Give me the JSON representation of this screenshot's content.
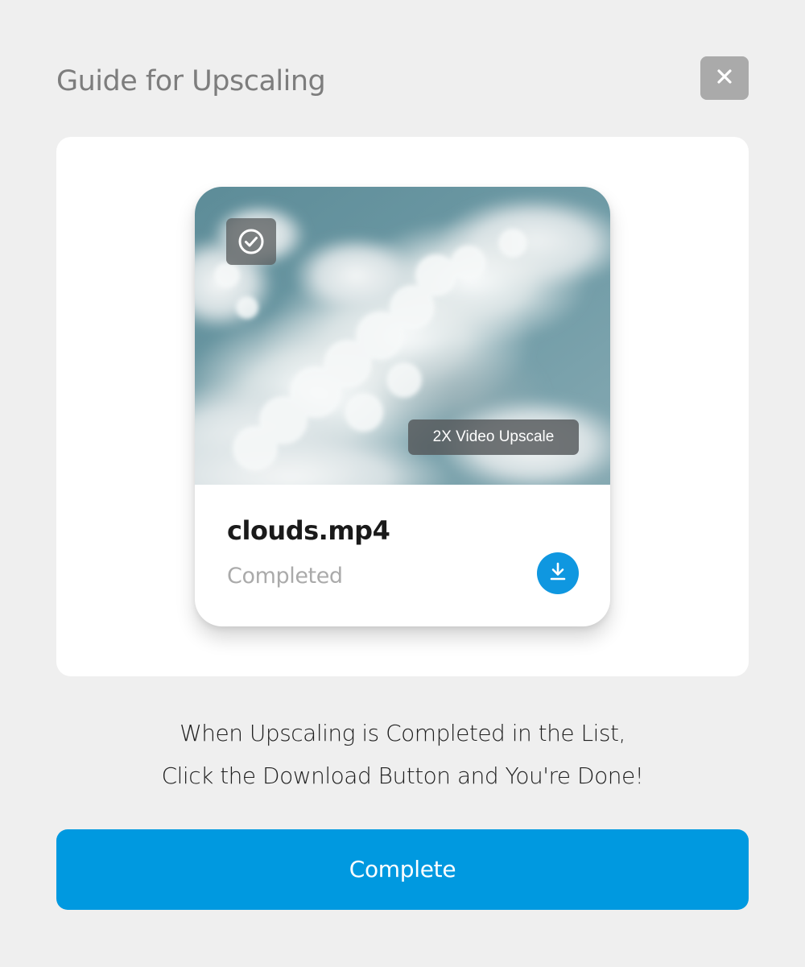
{
  "dialog": {
    "title": "Guide for Upscaling",
    "close_icon": "close-icon"
  },
  "preview": {
    "card": {
      "thumbnail_subject": "clouds-image",
      "select_icon": "check-circle-icon",
      "upscale_badge": "2X Video Upscale",
      "file_name": "clouds.mp4",
      "status": "Completed",
      "download_icon": "download-icon"
    }
  },
  "instructions": {
    "line1": "When Upscaling is Completed in the List,",
    "line2": "Click the Download Button and You're Done!"
  },
  "actions": {
    "complete_label": "Complete"
  },
  "colors": {
    "background": "#efefef",
    "accent": "#0099e0",
    "close_button": "#aaaaaa",
    "title": "#7d7d7d",
    "status_text": "#aaaaaa"
  }
}
